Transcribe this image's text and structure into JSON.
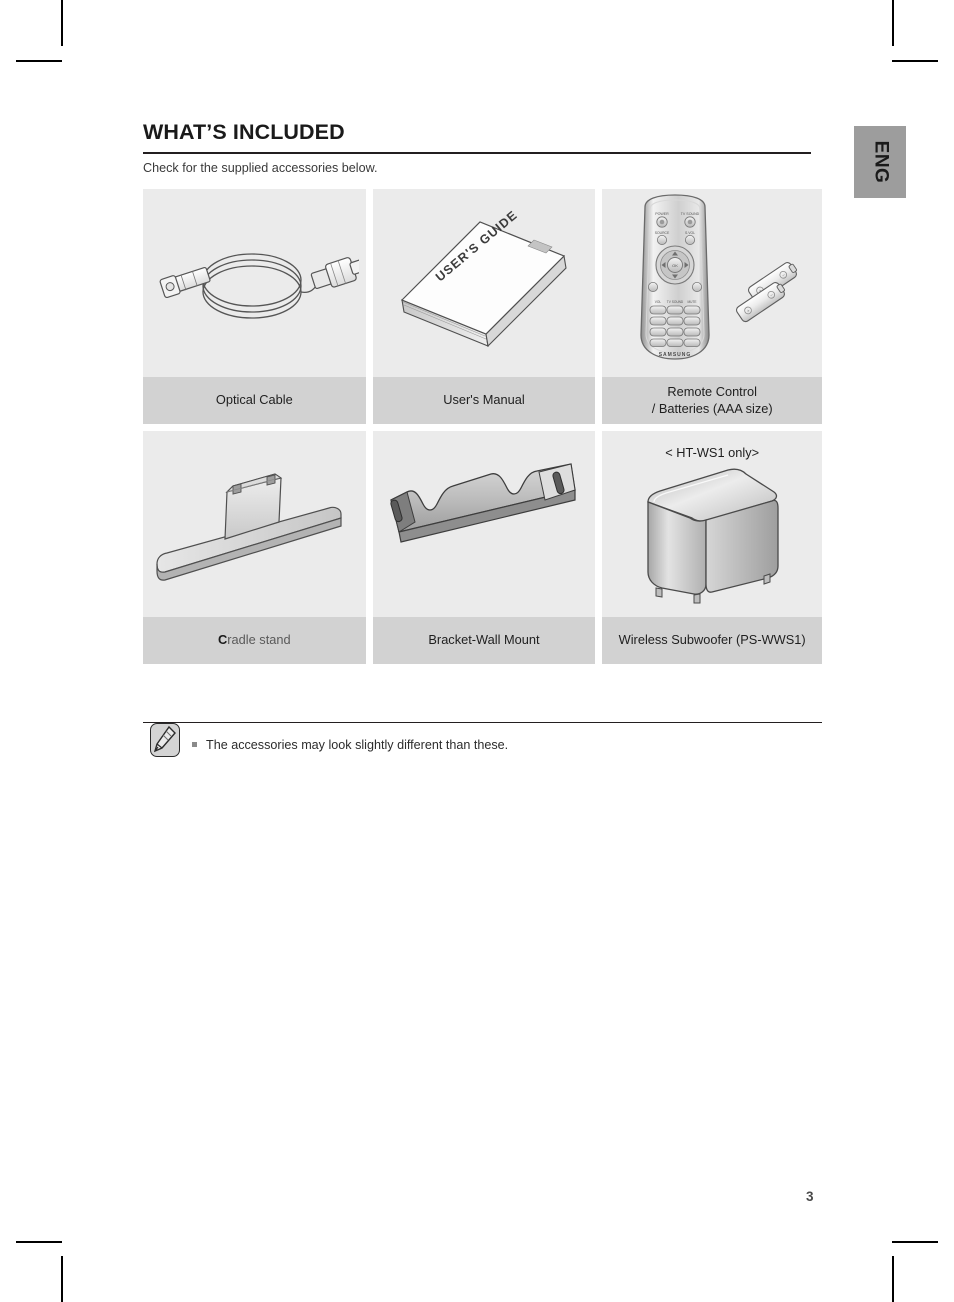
{
  "page": {
    "heading": "WHAT’S INCLUDED",
    "subtitle": "Check for the supplied accessories below.",
    "language_tab": "ENG",
    "page_number": "3"
  },
  "accessories": {
    "rows": [
      {
        "cells": [
          {
            "label_lines": [
              "Optical Cable"
            ],
            "icon": "optical-cable-illustration",
            "variant_note": ""
          },
          {
            "label_lines": [
              "User's Manual"
            ],
            "icon": "users-manual-illustration",
            "variant_note": ""
          },
          {
            "label_lines": [
              "Remote Control",
              "/ Batteries (AAA size)"
            ],
            "icon": "remote-control-batteries-illustration",
            "variant_note": ""
          }
        ]
      },
      {
        "cells": [
          {
            "label_c": "C",
            "label_rest": "radle stand",
            "label_lines": [
              "Cradle stand"
            ],
            "icon": "cradle-stand-illustration",
            "variant_note": ""
          },
          {
            "label_lines": [
              "Bracket-Wall Mount"
            ],
            "icon": "wall-mount-bracket-illustration",
            "variant_note": ""
          },
          {
            "label_lines": [
              "Wireless Subwoofer (PS-WWS1)"
            ],
            "icon": "wireless-subwoofer-illustration",
            "variant_note": "< HT-WS1 only>"
          }
        ]
      }
    ]
  },
  "note": {
    "icon": "note-pencil-icon",
    "bullet": "square-bullet",
    "text": "The accessories may look slightly different than these."
  },
  "manual_cover": {
    "title": "USER'S GUIDE"
  },
  "remote": {
    "brand": "SAMSUNG"
  },
  "colors": {
    "cell_bg": "#ebebeb",
    "label_bg": "#d2d2d2",
    "tab_bg": "#9d9d9d",
    "text": "#231f20"
  }
}
